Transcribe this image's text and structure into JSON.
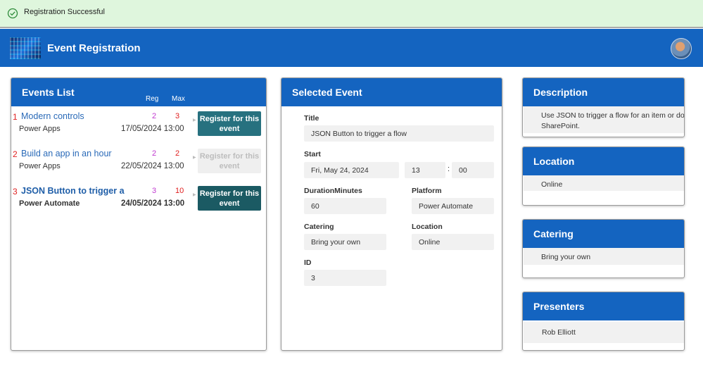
{
  "notification": {
    "message": "Registration Successful",
    "icon": "check-circle-icon",
    "color": "#dff6dd"
  },
  "header": {
    "title": "Event Registration",
    "accent": "#1464c0"
  },
  "events_list": {
    "title": "Events List",
    "col_reg": "Reg",
    "col_max": "Max",
    "rows": [
      {
        "num": "1",
        "title": "Modern controls",
        "platform": "Power Apps",
        "reg": "2",
        "max": "3",
        "date": "17/05/2024 13:00",
        "button": "Register for this event",
        "state": "enabled"
      },
      {
        "num": "2",
        "title": "Build an app in an hour",
        "platform": "Power Apps",
        "reg": "2",
        "max": "2",
        "date": "22/05/2024 13:00",
        "button": "Register for this event",
        "state": "disabled"
      },
      {
        "num": "3",
        "title": "JSON Button to trigger a",
        "platform": "Power Automate",
        "reg": "3",
        "max": "10",
        "date": "24/05/2024 13:00",
        "button": "Register for this event",
        "state": "selected"
      }
    ]
  },
  "selected_event": {
    "title": "Selected Event",
    "title_label": "Title",
    "title_value": "JSON Button to trigger a flow",
    "start_label": "Start",
    "start_date": "Fri, May 24, 2024",
    "start_hour": "13",
    "start_colon": ":",
    "start_minute": "00",
    "duration_label": "DurationMinutes",
    "duration_value": "60",
    "platform_label": "Platform",
    "platform_value": "Power Automate",
    "catering_label": "Catering",
    "catering_value": "Bring your own",
    "location_label": "Location",
    "location_value": "Online",
    "id_label": "ID",
    "id_value": "3"
  },
  "description": {
    "title": "Description",
    "text_line1": "Use JSON to trigger a flow for an item or doc",
    "text_line2": "SharePoint."
  },
  "location": {
    "title": "Location",
    "value": "Online"
  },
  "catering": {
    "title": "Catering",
    "value": "Bring your own"
  },
  "presenters": {
    "title": "Presenters",
    "value": "Rob Elliott"
  }
}
